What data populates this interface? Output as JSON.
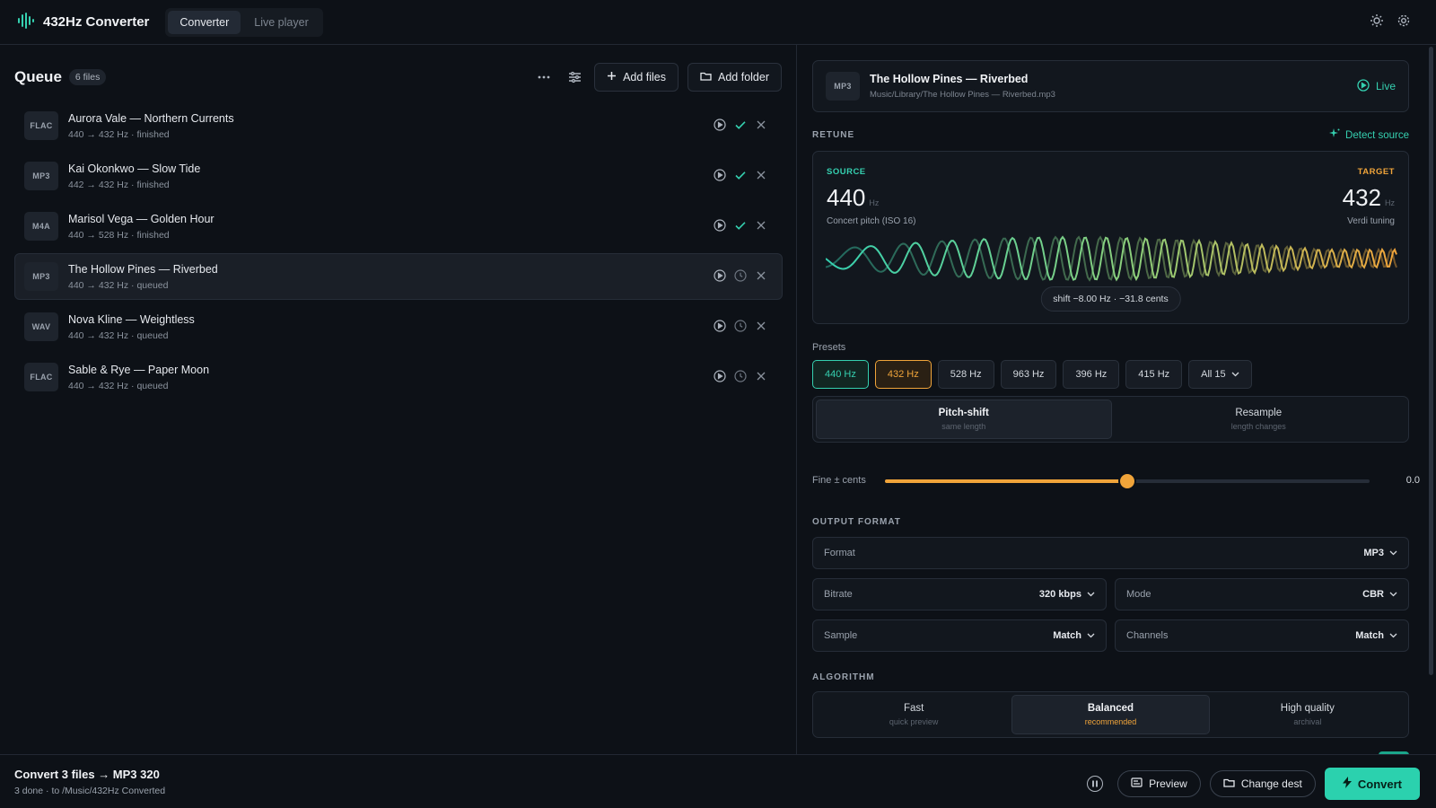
{
  "app": {
    "title": "432Hz Converter",
    "tabs": [
      {
        "label": "Converter",
        "active": true
      },
      {
        "label": "Live player",
        "active": false
      }
    ]
  },
  "colors": {
    "accent": "#35d0b0",
    "target": "#f0a43a",
    "background": "#0d1117"
  },
  "queue": {
    "title": "Queue",
    "count": "6 files",
    "add_files": "Add files",
    "add_folder": "Add folder",
    "items": [
      {
        "format": "FLAC",
        "title": "Aurora Vale — Northern Currents",
        "sub": "440 → 432 Hz · finished",
        "status": "done"
      },
      {
        "format": "MP3",
        "title": "Kai Okonkwo — Slow Tide",
        "sub": "442 → 432 Hz · finished",
        "status": "done"
      },
      {
        "format": "M4A",
        "title": "Marisol Vega — Golden Hour",
        "sub": "440 → 528 Hz · finished",
        "status": "done"
      },
      {
        "format": "MP3",
        "title": "The Hollow Pines — Riverbed",
        "sub": "440 → 432 Hz · queued",
        "status": "queued"
      },
      {
        "format": "WAV",
        "title": "Nova Kline — Weightless",
        "sub": "440 → 432 Hz · queued",
        "status": "queued"
      },
      {
        "format": "FLAC",
        "title": "Sable & Rye — Paper Moon",
        "sub": "440 → 432 Hz · queued",
        "status": "queued"
      }
    ]
  },
  "now_playing": {
    "format": "MP3",
    "title": "The Hollow Pines — Riverbed",
    "path": "Music/Library/The Hollow Pines — Riverbed.mp3",
    "live_label": "Live"
  },
  "retune": {
    "section": "RETUNE",
    "detect": "Detect source",
    "source_label": "SOURCE",
    "target_label": "TARGET",
    "source_value": "440",
    "target_value": "432",
    "unit": "Hz",
    "source_desc": "Concert pitch (ISO 16)",
    "target_desc": "Verdi tuning",
    "shift": "shift −8.00 Hz · −31.8 cents"
  },
  "presets": {
    "label": "Presets",
    "items": [
      "440 Hz",
      "432 Hz",
      "528 Hz",
      "963 Hz",
      "396 Hz",
      "415 Hz"
    ],
    "more": "All 15"
  },
  "mode": {
    "options": [
      {
        "title": "Pitch-shift",
        "sub": "same length",
        "active": true
      },
      {
        "title": "Resample",
        "sub": "length changes",
        "active": false
      }
    ]
  },
  "fine": {
    "label": "Fine ± cents",
    "value": "0.0",
    "position": 0.5
  },
  "output": {
    "section": "OUTPUT FORMAT",
    "format_label": "Format",
    "format_value": "MP3",
    "bitrate_label": "Bitrate",
    "bitrate_value": "320 kbps",
    "mode_label": "Mode",
    "mode_value": "CBR",
    "sample_label": "Sample",
    "sample_value": "Match",
    "channels_label": "Channels",
    "channels_value": "Match"
  },
  "algorithm": {
    "section": "ALGORITHM",
    "options": [
      {
        "title": "Fast",
        "sub": "quick preview",
        "active": false
      },
      {
        "title": "Balanced",
        "sub": "recommended",
        "active": true
      },
      {
        "title": "High quality",
        "sub": "archival",
        "active": false
      }
    ]
  },
  "footer": {
    "title": "Convert 3 files → MP3 320",
    "sub": "3 done · to /Music/432Hz Converted",
    "preview": "Preview",
    "change_dest": "Change dest",
    "convert": "Convert"
  }
}
